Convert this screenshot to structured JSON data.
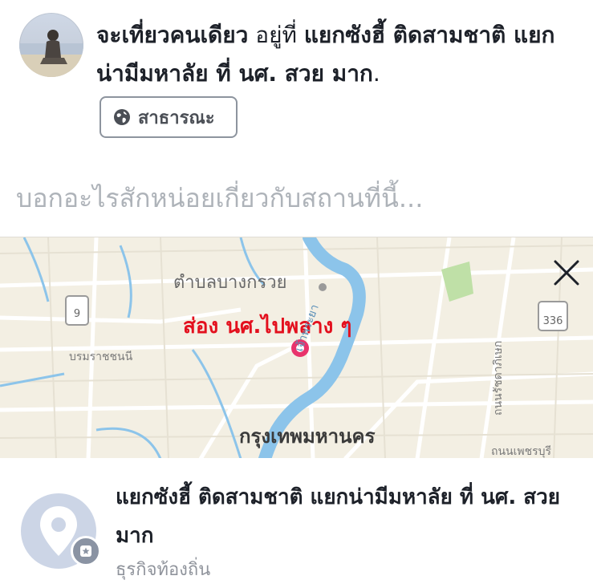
{
  "post": {
    "status_bold": "จะเที่ยวคนเดียว",
    "status_location_prefix": " อยู่ที่ ",
    "location_name": "แยกซังฮี้ ติดสามชาติ แยกน่ามีมหาลัย ที่ นศ. สวย มาก",
    "period": ".",
    "privacy_label": "สาธารณะ",
    "privacy_icon": "globe-icon",
    "composer_placeholder": "บอกอะไรสักหน่อยเกี่ยวกับสถานที่นี้..."
  },
  "map": {
    "pin_caption": "ส่อง นศ.ไปพลาง ๆ",
    "labels": {
      "district": "ตำบลบางกรวย",
      "city": "กรุงเทพมหานคร",
      "road_left": "บรมราชชนนี",
      "river": "เจ้าพระยา",
      "road_right_vertical": "ถนนรัชดาภิเษก",
      "road_right_bottom": "ถนนเพชรบุรี"
    },
    "highway_shields": [
      "9",
      "336"
    ],
    "close_icon": "close-icon",
    "pin_color": "#e8336c",
    "water_color": "#8cc4ea"
  },
  "place": {
    "name": "แยกซังฮี้ ติดสามชาติ แยกน่ามีมหาลัย ที่ นศ. สวย มาก",
    "category": "ธุรกิจท้องถิ่น",
    "icon": "map-pin-icon",
    "badge_icon": "star-icon"
  }
}
